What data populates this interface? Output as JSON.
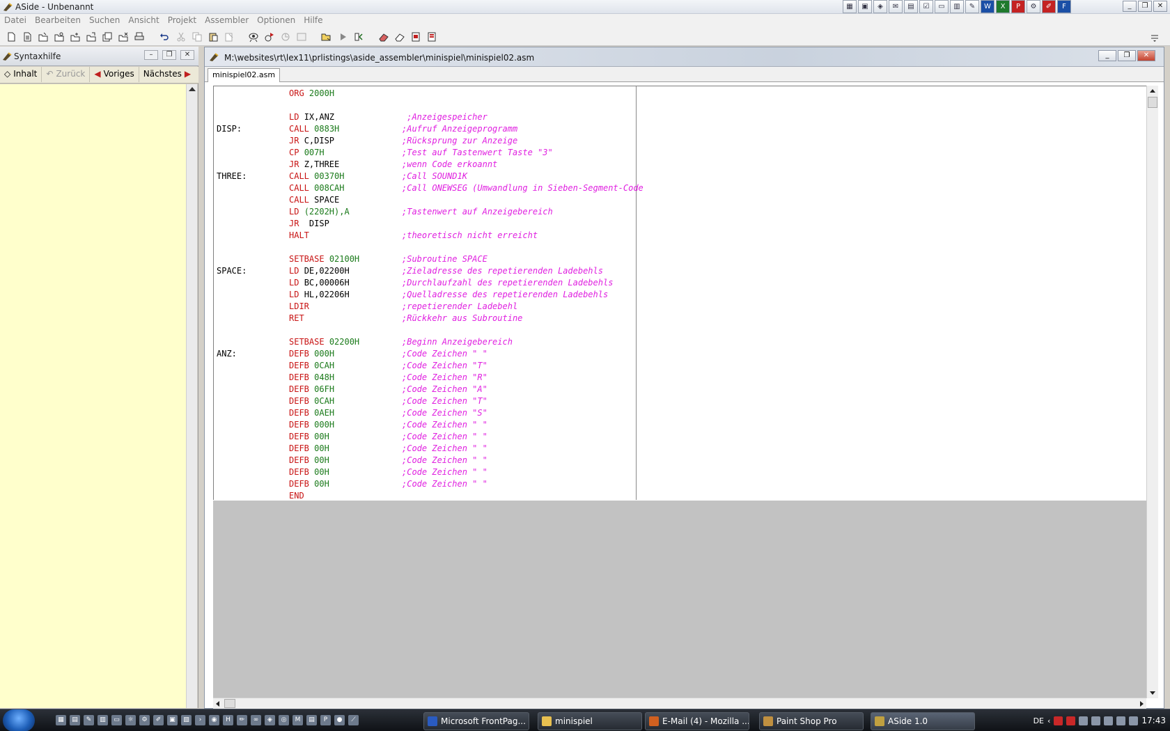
{
  "window": {
    "title": "ASide - Unbenannt"
  },
  "menubar": {
    "items": [
      "Datei",
      "Bearbeiten",
      "Suchen",
      "Ansicht",
      "Projekt",
      "Assembler",
      "Optionen",
      "Hilfe"
    ]
  },
  "syntaxhelp": {
    "title": "Syntaxhilfe",
    "nav": {
      "contents": "Inhalt",
      "back": "Zurück",
      "previous": "Voriges",
      "next": "Nächstes"
    }
  },
  "editor": {
    "title": "M:\\websites\\rt\\lex11\\prlistings\\aside_assembler\\minispiel\\minispiel02.asm",
    "tab": "minispiel02.asm",
    "colors": {
      "keyword": "#c81414",
      "number": "#1a7a1a",
      "comment": "#e020e0",
      "grey_area": "#c2c2c2"
    }
  },
  "code_lines": [
    {
      "label": "",
      "instr": "ORG",
      "operand": "2000H",
      "comment": ""
    },
    {
      "label": "",
      "instr": "",
      "operand": "",
      "comment": ""
    },
    {
      "label": "",
      "instr": "LD",
      "operand": "IX,ANZ",
      "comment": " ;Anzeigespeicher"
    },
    {
      "label": "DISP:",
      "instr": "CALL",
      "operand": "0883H",
      "comment": ";Aufruf Anzeigeprogramm"
    },
    {
      "label": "",
      "instr": "JR",
      "operand": "C,DISP",
      "comment": ";Rücksprung zur Anzeige"
    },
    {
      "label": "",
      "instr": "CP",
      "operand": "007H",
      "comment": ";Test auf Tastenwert Taste \"3\""
    },
    {
      "label": "",
      "instr": "JR",
      "operand": "Z,THREE",
      "comment": ";wenn Code erkoannt"
    },
    {
      "label": "THREE:",
      "instr": "CALL",
      "operand": "00370H",
      "comment": ";Call SOUND1K"
    },
    {
      "label": "",
      "instr": "CALL",
      "operand": "008CAH",
      "comment": ";Call ONEWSEG (Umwandlung in Sieben-Segment-Code"
    },
    {
      "label": "",
      "instr": "CALL",
      "operand": "SPACE",
      "comment": ""
    },
    {
      "label": "",
      "instr": "LD",
      "operand": "(2202H),A",
      "comment": ";Tastenwert auf Anzeigebereich"
    },
    {
      "label": "",
      "instr": "JR",
      "operand": " DISP",
      "comment": ""
    },
    {
      "label": "",
      "instr": "HALT",
      "operand": "",
      "comment": ";theoretisch nicht erreicht"
    },
    {
      "label": "",
      "instr": "",
      "operand": "",
      "comment": ""
    },
    {
      "label": "",
      "instr": "SETBASE",
      "operand": "02100H",
      "comment": ";Subroutine SPACE"
    },
    {
      "label": "SPACE:",
      "instr": "LD",
      "operand": "DE,02200H",
      "comment": ";Zieladresse des repetierenden Ladebehls"
    },
    {
      "label": "",
      "instr": "LD",
      "operand": "BC,00006H",
      "comment": ";Durchlaufzahl des repetierenden Ladebehls"
    },
    {
      "label": "",
      "instr": "LD",
      "operand": "HL,02206H",
      "comment": ";Quelladresse des repetierenden Ladebehls"
    },
    {
      "label": "",
      "instr": "LDIR",
      "operand": "",
      "comment": ";repetierender Ladebehl"
    },
    {
      "label": "",
      "instr": "RET",
      "operand": "",
      "comment": ";Rückkehr aus Subroutine"
    },
    {
      "label": "",
      "instr": "",
      "operand": "",
      "comment": ""
    },
    {
      "label": "",
      "instr": "SETBASE",
      "operand": "02200H",
      "comment": ";Beginn Anzeigebereich"
    },
    {
      "label": "ANZ:",
      "instr": "DEFB",
      "operand": "000H",
      "comment": ";Code Zeichen \" \""
    },
    {
      "label": "",
      "instr": "DEFB",
      "operand": "0CAH",
      "comment": ";Code Zeichen \"T\""
    },
    {
      "label": "",
      "instr": "DEFB",
      "operand": "048H",
      "comment": ";Code Zeichen \"R\""
    },
    {
      "label": "",
      "instr": "DEFB",
      "operand": "06FH",
      "comment": ";Code Zeichen \"A\""
    },
    {
      "label": "",
      "instr": "DEFB",
      "operand": "0CAH",
      "comment": ";Code Zeichen \"T\""
    },
    {
      "label": "",
      "instr": "DEFB",
      "operand": "0AEH",
      "comment": ";Code Zeichen \"S\""
    },
    {
      "label": "",
      "instr": "DEFB",
      "operand": "000H",
      "comment": ";Code Zeichen \" \""
    },
    {
      "label": "",
      "instr": "DEFB",
      "operand": "00H",
      "comment": ";Code Zeichen \" \""
    },
    {
      "label": "",
      "instr": "DEFB",
      "operand": "00H",
      "comment": ";Code Zeichen \" \""
    },
    {
      "label": "",
      "instr": "DEFB",
      "operand": "00H",
      "comment": ";Code Zeichen \" \""
    },
    {
      "label": "",
      "instr": "DEFB",
      "operand": "00H",
      "comment": ";Code Zeichen \" \""
    },
    {
      "label": "",
      "instr": "DEFB",
      "operand": "00H",
      "comment": ";Code Zeichen \" \""
    },
    {
      "label": "",
      "instr": "END",
      "operand": "",
      "comment": ""
    }
  ],
  "taskbar": {
    "tasks": [
      {
        "label": "Microsoft FrontPag...",
        "icon": "frontpage-icon"
      },
      {
        "label": "minispiel",
        "icon": "folder-icon"
      },
      {
        "label": "E-Mail (4) - Mozilla ...",
        "icon": "thunderbird-icon"
      },
      {
        "label": "Paint Shop Pro",
        "icon": "paintshop-icon"
      },
      {
        "label": "ASide 1.0",
        "icon": "aside-icon"
      }
    ],
    "language": "DE",
    "clock": "17:43"
  }
}
